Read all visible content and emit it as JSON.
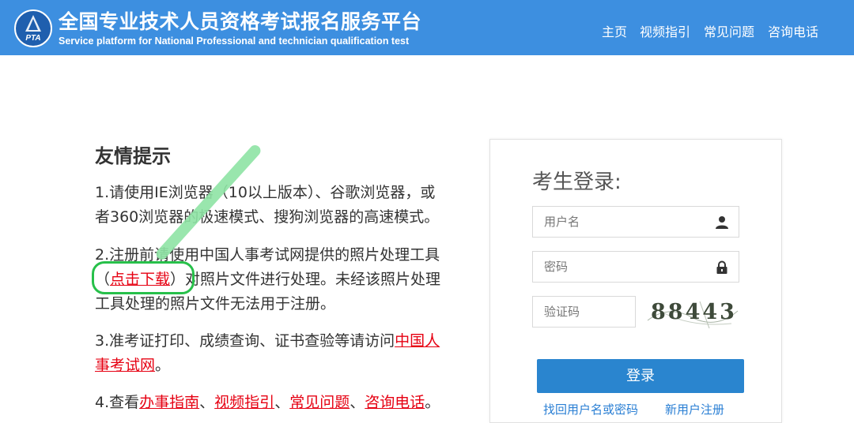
{
  "header": {
    "logo_text": "PTA",
    "title": "全国专业技术人员资格考试报名服务平台",
    "subtitle": "Service platform for National Professional and technician qualification test",
    "nav": [
      "主页",
      "视频指引",
      "常见问题",
      "咨询电话"
    ]
  },
  "notice": {
    "title": "友情提示",
    "item1_line1": "1.请使用IE浏览器（10以上版本）、谷歌浏览器，或",
    "item1_line2": "者360浏览器的极速模式、搜狗浏览器的高速模式。",
    "item2_line1": "2.注册前请使用中国人事考试网提供的照片处理工具",
    "item2_open": "（",
    "item2_link": "点击下载",
    "item2_rest": "）对照片文件进行处理。未经该照片处理",
    "item2_line3": "工具处理的照片文件无法用于注册。",
    "item3_text": "3.准考证打印、成绩查询、证书查验等请访问",
    "item3_link_a": "中国人",
    "item3_link_b": "事考试网",
    "item3_end": "。",
    "item4_prefix": "4.查看",
    "item4_links": [
      "办事指南",
      "视频指引",
      "常见问题",
      "咨询电话"
    ],
    "item4_sep": "、",
    "item4_end": "。"
  },
  "login": {
    "title": "考生登录:",
    "username_placeholder": "用户名",
    "password_placeholder": "密码",
    "captcha_placeholder": "验证码",
    "captcha_code": "88443",
    "submit_label": "登录",
    "forgot_link": "找回用户名或密码",
    "register_link": "新用户注册"
  },
  "colors": {
    "header_bg": "#3d8fe0",
    "link_red": "#e60012",
    "button_blue": "#2a85cf",
    "annotation_green": "#27c04a"
  }
}
